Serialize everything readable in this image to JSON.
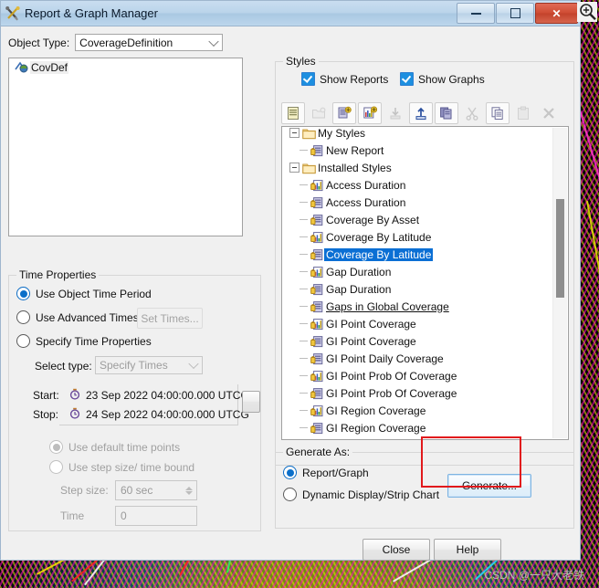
{
  "window": {
    "title": "Report & Graph Manager",
    "title_icon": "tools-icon",
    "controls": {
      "minimize": "minimize-icon",
      "maximize": "maximize-icon",
      "close": "close-icon"
    }
  },
  "object_type": {
    "label": "Object Type:",
    "value": "CoverageDefinition"
  },
  "object_tree": {
    "items": [
      {
        "label": "CovDef",
        "icon": "coverage-definition-icon",
        "selected": true
      }
    ]
  },
  "time_properties": {
    "legend": "Time Properties",
    "options": [
      {
        "label": "Use Object Time Period",
        "selected": true,
        "enabled": true
      },
      {
        "label": "Use Advanced Times",
        "selected": false,
        "enabled": true
      },
      {
        "label": "Specify Time Properties",
        "selected": false,
        "enabled": true
      }
    ],
    "set_times_button": "Set Times...",
    "select_type_label": "Select type:",
    "select_type_value": "Specify Times",
    "start_label": "Start:",
    "start_value": "23 Sep 2022 04:00:00.000 UTCG",
    "stop_label": "Stop:",
    "stop_value": "24 Sep 2022 04:00:00.000 UTCG",
    "time_point_options": [
      {
        "label": "Use default time points",
        "selected": true,
        "enabled": false
      },
      {
        "label": "Use step size/ time bound",
        "selected": false,
        "enabled": false
      }
    ],
    "step_size_label": "Step size:",
    "step_size_value": "60 sec",
    "time_label": "Time",
    "time_value": "0"
  },
  "styles": {
    "legend": "Styles",
    "show_reports": {
      "label": "Show Reports",
      "checked": true
    },
    "show_graphs": {
      "label": "Show Graphs",
      "checked": true
    },
    "toolbar": [
      {
        "name": "new-report-icon",
        "enabled": true
      },
      {
        "name": "new-folder-icon",
        "enabled": false
      },
      {
        "name": "duplicate-report-icon",
        "enabled": true
      },
      {
        "name": "duplicate-graph-icon",
        "enabled": true
      },
      {
        "name": "import-icon",
        "enabled": false
      },
      {
        "name": "export-icon",
        "enabled": true
      },
      {
        "name": "copy-style-icon",
        "enabled": true
      },
      {
        "name": "cut-icon",
        "enabled": false
      },
      {
        "name": "copy-icon",
        "enabled": true
      },
      {
        "name": "paste-icon",
        "enabled": false
      },
      {
        "name": "delete-icon",
        "enabled": false
      }
    ],
    "tree": [
      {
        "label": "Access Duration",
        "icon": "graph-icon",
        "depth": 1,
        "type": "leaf"
      },
      {
        "label": "My Styles",
        "icon": "folder-icon",
        "depth": 0,
        "type": "folder"
      },
      {
        "label": "New Report",
        "icon": "report-icon",
        "depth": 1,
        "type": "leaf"
      },
      {
        "label": "Installed Styles",
        "icon": "folder-icon",
        "depth": 0,
        "type": "folder"
      },
      {
        "label": "Access Duration",
        "icon": "graph-icon",
        "depth": 1,
        "type": "leaf"
      },
      {
        "label": "Access Duration",
        "icon": "report-icon",
        "depth": 1,
        "type": "leaf"
      },
      {
        "label": "Coverage By Asset",
        "icon": "report-icon",
        "depth": 1,
        "type": "leaf"
      },
      {
        "label": "Coverage By Latitude",
        "icon": "graph-icon",
        "depth": 1,
        "type": "leaf"
      },
      {
        "label": "Coverage By Latitude",
        "icon": "report-icon",
        "depth": 1,
        "type": "leaf",
        "selected": true
      },
      {
        "label": "Gap Duration",
        "icon": "graph-icon",
        "depth": 1,
        "type": "leaf"
      },
      {
        "label": "Gap Duration",
        "icon": "report-icon",
        "depth": 1,
        "type": "leaf"
      },
      {
        "label": "Gaps in Global Coverage",
        "icon": "report-icon",
        "depth": 1,
        "type": "leaf",
        "link": true
      },
      {
        "label": "GI Point Coverage",
        "icon": "graph-icon",
        "depth": 1,
        "type": "leaf"
      },
      {
        "label": "GI Point Coverage",
        "icon": "report-icon",
        "depth": 1,
        "type": "leaf"
      },
      {
        "label": "GI Point Daily Coverage",
        "icon": "report-icon",
        "depth": 1,
        "type": "leaf"
      },
      {
        "label": "GI Point Prob Of Coverage",
        "icon": "graph-icon",
        "depth": 1,
        "type": "leaf"
      },
      {
        "label": "GI Point Prob Of Coverage",
        "icon": "report-icon",
        "depth": 1,
        "type": "leaf"
      },
      {
        "label": "GI Region Coverage",
        "icon": "graph-icon",
        "depth": 1,
        "type": "leaf"
      },
      {
        "label": "GI Region Coverage",
        "icon": "report-icon",
        "depth": 1,
        "type": "leaf"
      }
    ]
  },
  "generate_as": {
    "legend": "Generate As:",
    "options": [
      {
        "label": "Report/Graph",
        "selected": true
      },
      {
        "label": "Dynamic Display/Strip Chart",
        "selected": false
      }
    ],
    "generate_button": "Generate..."
  },
  "footer": {
    "close_button": "Close",
    "help_button": "Help"
  },
  "annotation": {
    "highlight_color": "#e1191c",
    "target": "generate-button"
  },
  "watermark": {
    "text": "CSDN @一只大老铁"
  }
}
